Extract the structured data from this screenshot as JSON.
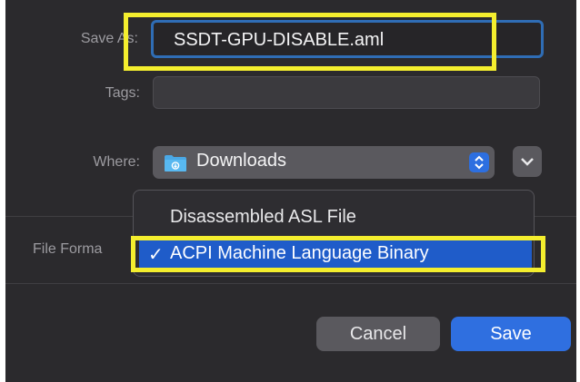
{
  "dialog": {
    "save_as_label": "Save As:",
    "save_as_value": "SSDT-GPU-DISABLE.aml",
    "tags_label": "Tags:",
    "where_label": "Where:",
    "where_value": "Downloads",
    "file_format_label": "File Forma",
    "file_format_menu": {
      "options": [
        "Disassembled ASL File",
        "ACPI Machine Language Binary"
      ],
      "selected_index": 1,
      "check_mark": "✓"
    },
    "cancel_label": "Cancel",
    "save_label": "Save"
  },
  "colors": {
    "background": "#2b2a2d",
    "accent": "#2f6fe0",
    "highlight_annotation": "#f4ee2e",
    "menu_selection": "#1f5cc9"
  },
  "icons": {
    "folder": "downloads-folder-icon",
    "stepper": "up-down-chevron-icon",
    "expand": "chevron-down-icon"
  }
}
